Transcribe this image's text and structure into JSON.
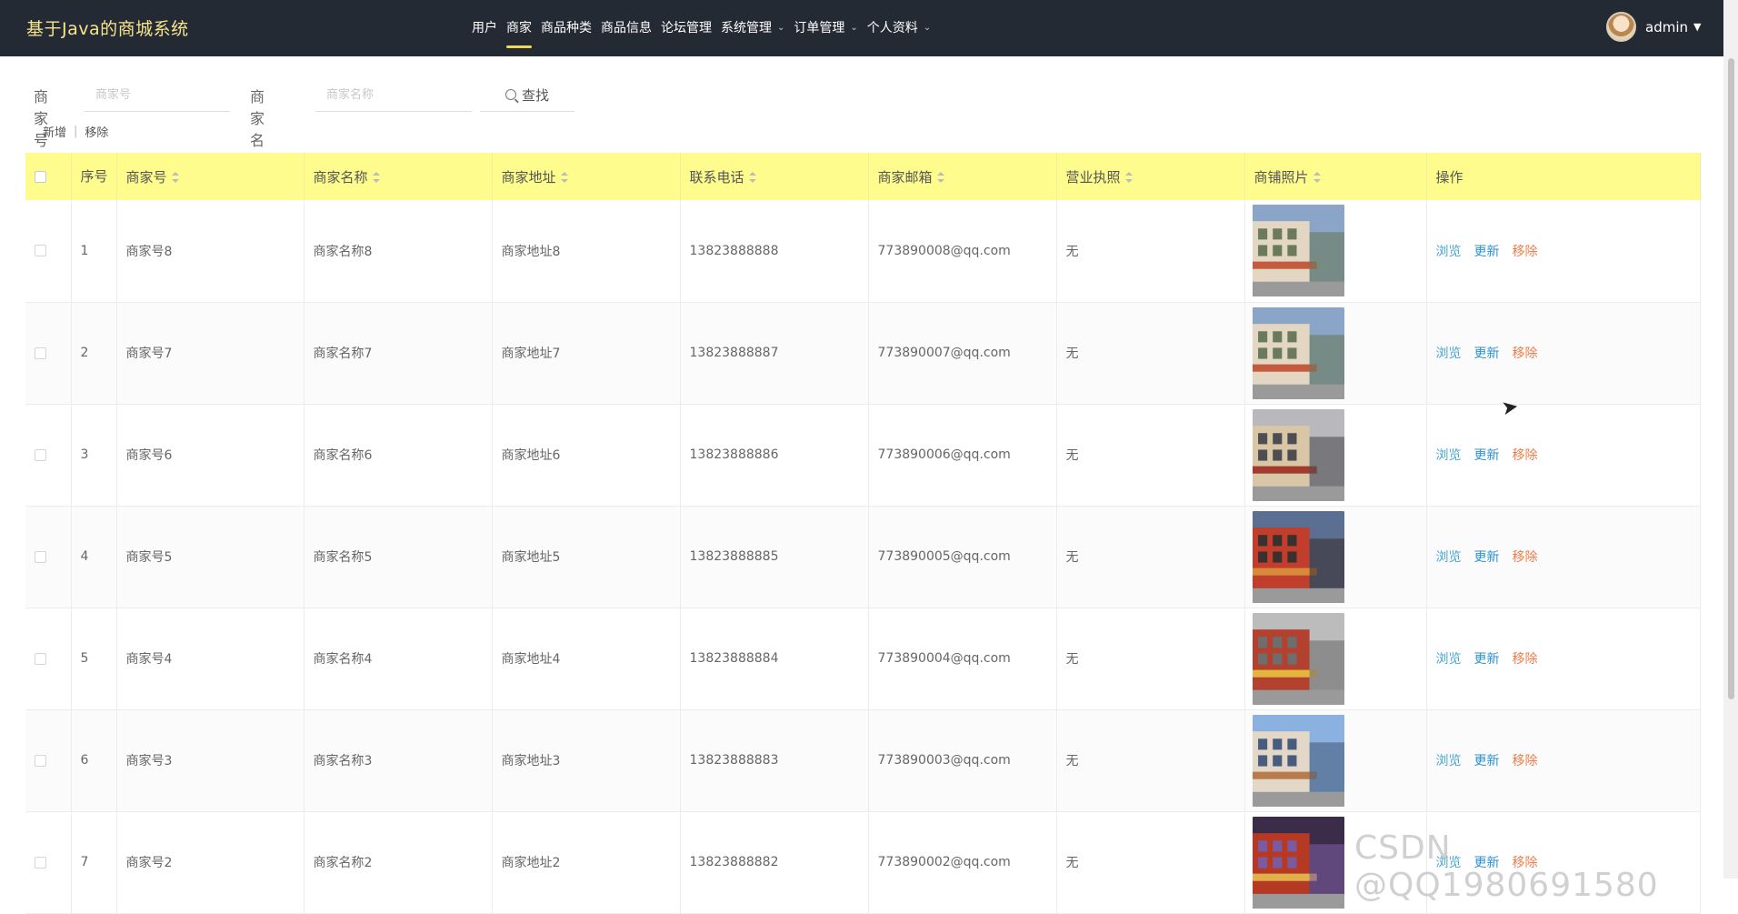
{
  "app": {
    "title": "基于Java的商城系统",
    "user": "admin"
  },
  "nav": {
    "items": [
      {
        "label": "用户",
        "active": false,
        "dropdown": false
      },
      {
        "label": "商家",
        "active": true,
        "dropdown": false
      },
      {
        "label": "商品种类",
        "active": false,
        "dropdown": false
      },
      {
        "label": "商品信息",
        "active": false,
        "dropdown": false
      },
      {
        "label": "论坛管理",
        "active": false,
        "dropdown": false
      },
      {
        "label": "系统管理",
        "active": false,
        "dropdown": true
      },
      {
        "label": "订单管理",
        "active": false,
        "dropdown": true
      },
      {
        "label": "个人资料",
        "active": false,
        "dropdown": true
      }
    ]
  },
  "search": {
    "merchant_no_label": "商家号",
    "merchant_no_placeholder": "商家号",
    "merchant_name_label": "商家名称",
    "merchant_name_placeholder": "商家名称",
    "search_button": "查找"
  },
  "actions": {
    "add": "新增",
    "remove": "移除"
  },
  "table": {
    "headers": {
      "index": "序号",
      "merchant_no": "商家号",
      "merchant_name": "商家名称",
      "address": "商家地址",
      "phone": "联系电话",
      "email": "商家邮箱",
      "license": "营业执照",
      "photo": "商铺照片",
      "ops": "操作"
    },
    "op_labels": {
      "view": "浏览",
      "edit": "更新",
      "delete": "移除"
    },
    "rows": [
      {
        "index": "1",
        "merchant_no": "商家号8",
        "merchant_name": "商家名称8",
        "address": "商家地址8",
        "phone": "13823888888",
        "email": "773890008@qq.com",
        "license": "无"
      },
      {
        "index": "2",
        "merchant_no": "商家号7",
        "merchant_name": "商家名称7",
        "address": "商家地址7",
        "phone": "13823888887",
        "email": "773890007@qq.com",
        "license": "无"
      },
      {
        "index": "3",
        "merchant_no": "商家号6",
        "merchant_name": "商家名称6",
        "address": "商家地址6",
        "phone": "13823888886",
        "email": "773890006@qq.com",
        "license": "无"
      },
      {
        "index": "4",
        "merchant_no": "商家号5",
        "merchant_name": "商家名称5",
        "address": "商家地址5",
        "phone": "13823888885",
        "email": "773890005@qq.com",
        "license": "无"
      },
      {
        "index": "5",
        "merchant_no": "商家号4",
        "merchant_name": "商家名称4",
        "address": "商家地址4",
        "phone": "13823888884",
        "email": "773890004@qq.com",
        "license": "无"
      },
      {
        "index": "6",
        "merchant_no": "商家号3",
        "merchant_name": "商家名称3",
        "address": "商家地址3",
        "phone": "13823888883",
        "email": "773890003@qq.com",
        "license": "无"
      },
      {
        "index": "7",
        "merchant_no": "商家号2",
        "merchant_name": "商家名称2",
        "address": "商家地址2",
        "phone": "13823888882",
        "email": "773890002@qq.com",
        "license": "无"
      }
    ]
  },
  "watermark": "CSDN @QQ1980691580",
  "colors": {
    "topbar": "#242a33",
    "brand": "#f6e58d",
    "header_row": "#fdfc8c",
    "view_link": "#49a5d3",
    "edit_link": "#2d92d4",
    "delete_link": "#ef7b4b"
  }
}
